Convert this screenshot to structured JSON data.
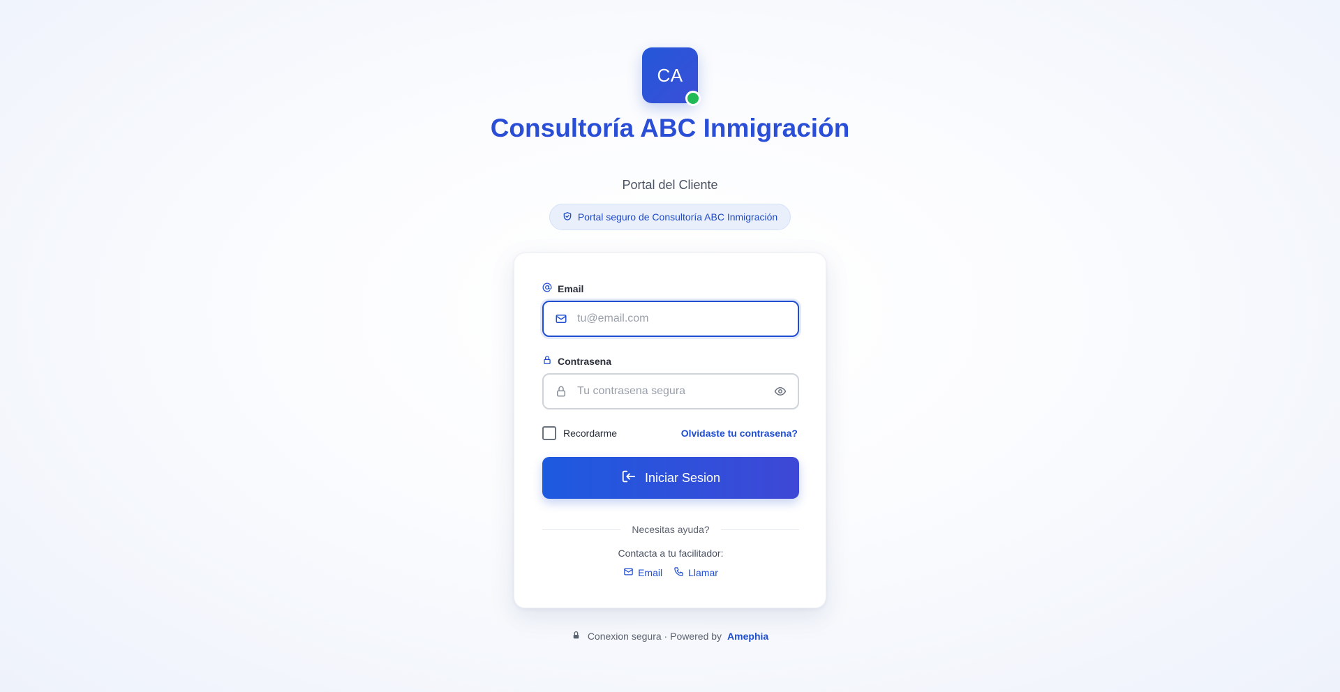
{
  "brand": {
    "logo_initials": "CA",
    "title": "Consultoría ABC Inmigración",
    "subtitle": "Portal del Cliente",
    "secure_badge": "Portal seguro de Consultoría ABC Inmigración",
    "primary_color": "#2a4ed6",
    "status_dot_color": "#22b957"
  },
  "form": {
    "email_label": "Email",
    "email_placeholder": "tu@email.com",
    "email_value": "",
    "password_label": "Contrasena",
    "password_placeholder": "Tu contrasena segura",
    "password_value": "",
    "remember_label": "Recordarme",
    "remember_checked": false,
    "forgot_link": "Olvidaste tu contrasena?",
    "submit_label": "Iniciar Sesion"
  },
  "help": {
    "divider_text": "Necesitas ayuda?",
    "contact_text": "Contacta a tu facilitador:",
    "email_link": "Email",
    "call_link": "Llamar"
  },
  "footer": {
    "secure_text": "Conexion segura · Powered by",
    "powered_by": "Amephia"
  },
  "icons": {
    "at": "at-icon",
    "mail": "mail-icon",
    "lock": "lock-icon",
    "eye": "eye-icon",
    "shield": "shield-check-icon",
    "login": "login-icon",
    "phone": "phone-icon"
  }
}
